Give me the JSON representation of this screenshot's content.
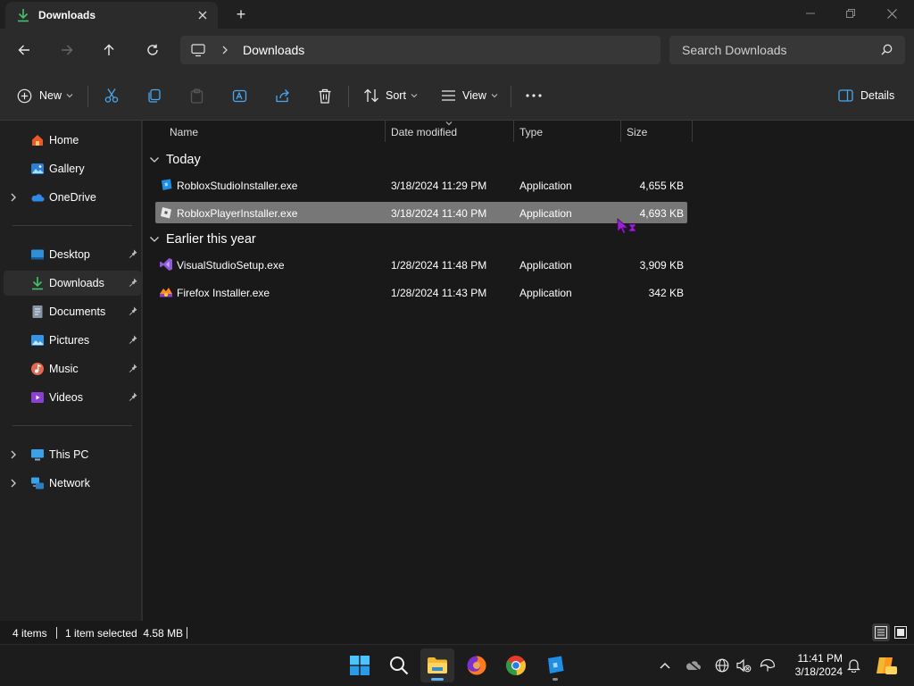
{
  "window": {
    "tab_title": "Downloads",
    "new_tab_symbol": "+"
  },
  "address": {
    "breadcrumb": "Downloads",
    "search_placeholder": "Search Downloads"
  },
  "toolbar": {
    "new_label": "New",
    "sort_label": "Sort",
    "view_label": "View",
    "details_label": "Details"
  },
  "sidebar": {
    "quick": [
      {
        "label": "Home",
        "icon": "home-icon"
      },
      {
        "label": "Gallery",
        "icon": "gallery-icon"
      },
      {
        "label": "OneDrive",
        "icon": "onedrive-icon",
        "expandable": true
      }
    ],
    "pinned": [
      {
        "label": "Desktop",
        "icon": "desktop-icon"
      },
      {
        "label": "Downloads",
        "icon": "download-icon",
        "selected": true
      },
      {
        "label": "Documents",
        "icon": "documents-icon"
      },
      {
        "label": "Pictures",
        "icon": "pictures-icon"
      },
      {
        "label": "Music",
        "icon": "music-icon"
      },
      {
        "label": "Videos",
        "icon": "videos-icon"
      }
    ],
    "devices": [
      {
        "label": "This PC",
        "icon": "this-pc-icon"
      },
      {
        "label": "Network",
        "icon": "network-icon"
      }
    ]
  },
  "columns": {
    "name": "Name",
    "date": "Date modified",
    "type": "Type",
    "size": "Size"
  },
  "groups": [
    {
      "label": "Today",
      "files": [
        {
          "name": "RobloxStudioInstaller.exe",
          "date": "3/18/2024 11:29 PM",
          "type": "Application",
          "size": "4,655 KB",
          "icon": "roblox-studio-icon",
          "selected": false
        },
        {
          "name": "RobloxPlayerInstaller.exe",
          "date": "3/18/2024 11:40 PM",
          "type": "Application",
          "size": "4,693 KB",
          "icon": "roblox-player-icon",
          "selected": true
        }
      ]
    },
    {
      "label": "Earlier this year",
      "files": [
        {
          "name": "VisualStudioSetup.exe",
          "date": "1/28/2024 11:48 PM",
          "type": "Application",
          "size": "3,909 KB",
          "icon": "visual-studio-icon",
          "selected": false
        },
        {
          "name": "Firefox Installer.exe",
          "date": "1/28/2024 11:43 PM",
          "type": "Application",
          "size": "342 KB",
          "icon": "firefox-icon",
          "selected": false
        }
      ]
    }
  ],
  "status": {
    "item_count": "4 items",
    "selection": "1 item selected  4.58 MB"
  },
  "taskbar": {
    "time": "11:41 PM",
    "date": "3/18/2024"
  },
  "colors": {
    "accent": "#5fb2f2",
    "selected_row": "#777777",
    "cursor": "#9a1fd6"
  }
}
